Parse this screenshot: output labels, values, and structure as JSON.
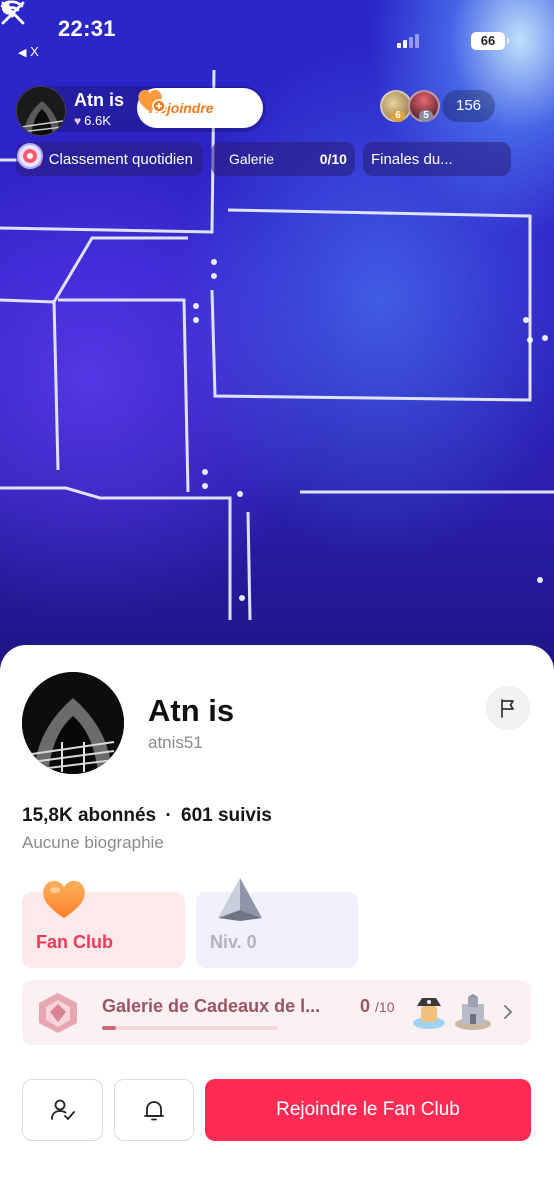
{
  "status_bar": {
    "time": "22:31",
    "back_app": "X",
    "battery": "66"
  },
  "host": {
    "name": "Atn is",
    "likes": "6.6K",
    "join_label": "Rejoindre"
  },
  "viewers": {
    "ranks": [
      "6",
      "5"
    ],
    "count": "156"
  },
  "chips": {
    "ranking": "Classement quotidien",
    "gallery_label": "Galerie",
    "gallery_count": "0/10",
    "finals": "Finales du..."
  },
  "profile": {
    "name": "Atn is",
    "handle": "atnis51",
    "followers": "15,8K abonnés",
    "separator": "·",
    "following": "601 suivis",
    "bio": "Aucune biographie"
  },
  "cards": {
    "fan_club": "Fan Club",
    "level": "Niv. 0"
  },
  "gallery": {
    "title": "Galerie de Cadeaux de l...",
    "collected": "0",
    "total": "/10",
    "progress": 0.08
  },
  "actions": {
    "join_fan_club": "Rejoindre le Fan Club"
  },
  "colors": {
    "accent": "#fe2c55",
    "fan_club_text": "#ed3b5a",
    "join_pill_text": "#f57b1e"
  }
}
